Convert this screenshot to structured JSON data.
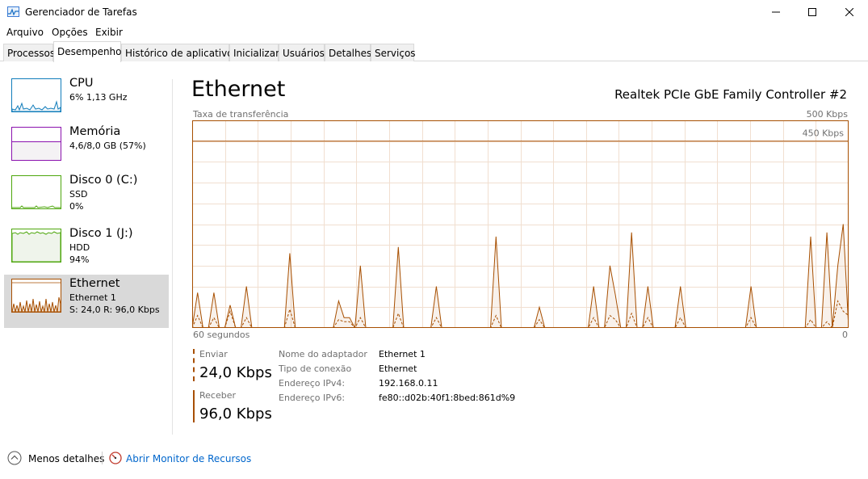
{
  "window": {
    "title": "Gerenciador de Tarefas"
  },
  "menu": [
    "Arquivo",
    "Opções",
    "Exibir"
  ],
  "tabs": [
    "Processos",
    "Desempenho",
    "Histórico de aplicativos",
    "Inicializar",
    "Usuários",
    "Detalhes",
    "Serviços"
  ],
  "active_tab": "Desempenho",
  "sidebar": {
    "items": [
      {
        "name": "CPU",
        "line1": "6%  1,13 GHz",
        "line2": "",
        "line3": ""
      },
      {
        "name": "Memória",
        "line1": "4,6/8,0 GB (57%)",
        "line2": "",
        "line3": ""
      },
      {
        "name": "Disco 0 (C:)",
        "line1": "SSD",
        "line2": "0%",
        "line3": ""
      },
      {
        "name": "Disco 1 (J:)",
        "line1": "HDD",
        "line2": "94%",
        "line3": ""
      },
      {
        "name": "Ethernet",
        "line1": "Ethernet 1",
        "line2": "S: 24,0  R: 96,0 Kbps",
        "line3": ""
      }
    ],
    "active_index": 4,
    "colors": {
      "cpu": "#117dbb",
      "memory": "#8b12ae",
      "disk": "#4da60c",
      "ethernet": "#a74f01"
    }
  },
  "main": {
    "title": "Ethernet",
    "adapter": "Realtek PCIe GbE Family Controller #2",
    "throughput_label": "Taxa de transferência",
    "max_label": "500 Kbps",
    "ref_label": "450 Kbps",
    "time_label_left": "60 segundos",
    "time_label_right": "0"
  },
  "stats": {
    "send_label": "Enviar",
    "send_value": "24,0 Kbps",
    "receive_label": "Receber",
    "receive_value": "96,0 Kbps"
  },
  "info": [
    {
      "label": "Nome do adaptador",
      "value": "Ethernet 1"
    },
    {
      "label": "Tipo de conexão",
      "value": "Ethernet"
    },
    {
      "label": "Endereço IPv4:",
      "value": "192.168.0.11"
    },
    {
      "label": "Endereço IPv6:",
      "value": "fe80::d02b:40f1:8bed:861d%9"
    }
  ],
  "footer": {
    "fewer_details": "Menos detalhes",
    "resource_monitor": "Abrir Monitor de Recursos"
  },
  "chart_data": {
    "type": "line",
    "title": "",
    "xlabel": "",
    "ylabel": "Taxa de transferência",
    "x_unit": "segundos",
    "ylim": [
      0,
      500
    ],
    "y_unit": "Kbps",
    "reference_line": 450,
    "grid": true,
    "color": "#a74f01",
    "series": [
      {
        "name": "Receber",
        "style": "solid-filled",
        "values": [
          0,
          85,
          0,
          0,
          85,
          0,
          0,
          55,
          0,
          0,
          100,
          0,
          0,
          0,
          0,
          0,
          0,
          0,
          180,
          0,
          0,
          0,
          0,
          0,
          0,
          0,
          0,
          65,
          25,
          25,
          0,
          150,
          0,
          0,
          0,
          0,
          0,
          0,
          195,
          0,
          0,
          0,
          0,
          0,
          0,
          100,
          0,
          0,
          0,
          0,
          0,
          0,
          0,
          0,
          0,
          0,
          220,
          0,
          0,
          0,
          0,
          0,
          0,
          0,
          50,
          0,
          0,
          0,
          0,
          0,
          0,
          0,
          0,
          0,
          100,
          0,
          0,
          150,
          80,
          0,
          0,
          230,
          0,
          0,
          100,
          0,
          0,
          0,
          0,
          0,
          100,
          0,
          0,
          0,
          0,
          0,
          0,
          0,
          0,
          0,
          0,
          0,
          0,
          100,
          0,
          0,
          0,
          0,
          0,
          0,
          0,
          0,
          0,
          0,
          220,
          0,
          0,
          230,
          0,
          150,
          250,
          0
        ]
      },
      {
        "name": "Enviar",
        "style": "dashed",
        "values": [
          0,
          30,
          0,
          0,
          25,
          0,
          0,
          40,
          0,
          0,
          25,
          0,
          0,
          0,
          0,
          0,
          0,
          0,
          45,
          0,
          0,
          0,
          0,
          0,
          0,
          0,
          0,
          20,
          15,
          15,
          0,
          25,
          0,
          0,
          0,
          0,
          0,
          0,
          35,
          0,
          0,
          0,
          0,
          0,
          0,
          25,
          0,
          0,
          0,
          0,
          0,
          0,
          0,
          0,
          0,
          0,
          30,
          0,
          0,
          0,
          0,
          0,
          0,
          0,
          20,
          0,
          0,
          0,
          0,
          0,
          0,
          0,
          0,
          0,
          25,
          0,
          0,
          30,
          20,
          0,
          0,
          35,
          0,
          0,
          25,
          0,
          0,
          0,
          0,
          0,
          25,
          0,
          0,
          0,
          0,
          0,
          0,
          0,
          0,
          0,
          0,
          0,
          0,
          25,
          0,
          0,
          0,
          0,
          0,
          0,
          0,
          0,
          0,
          0,
          20,
          0,
          0,
          15,
          0,
          65,
          40,
          30
        ]
      }
    ]
  }
}
